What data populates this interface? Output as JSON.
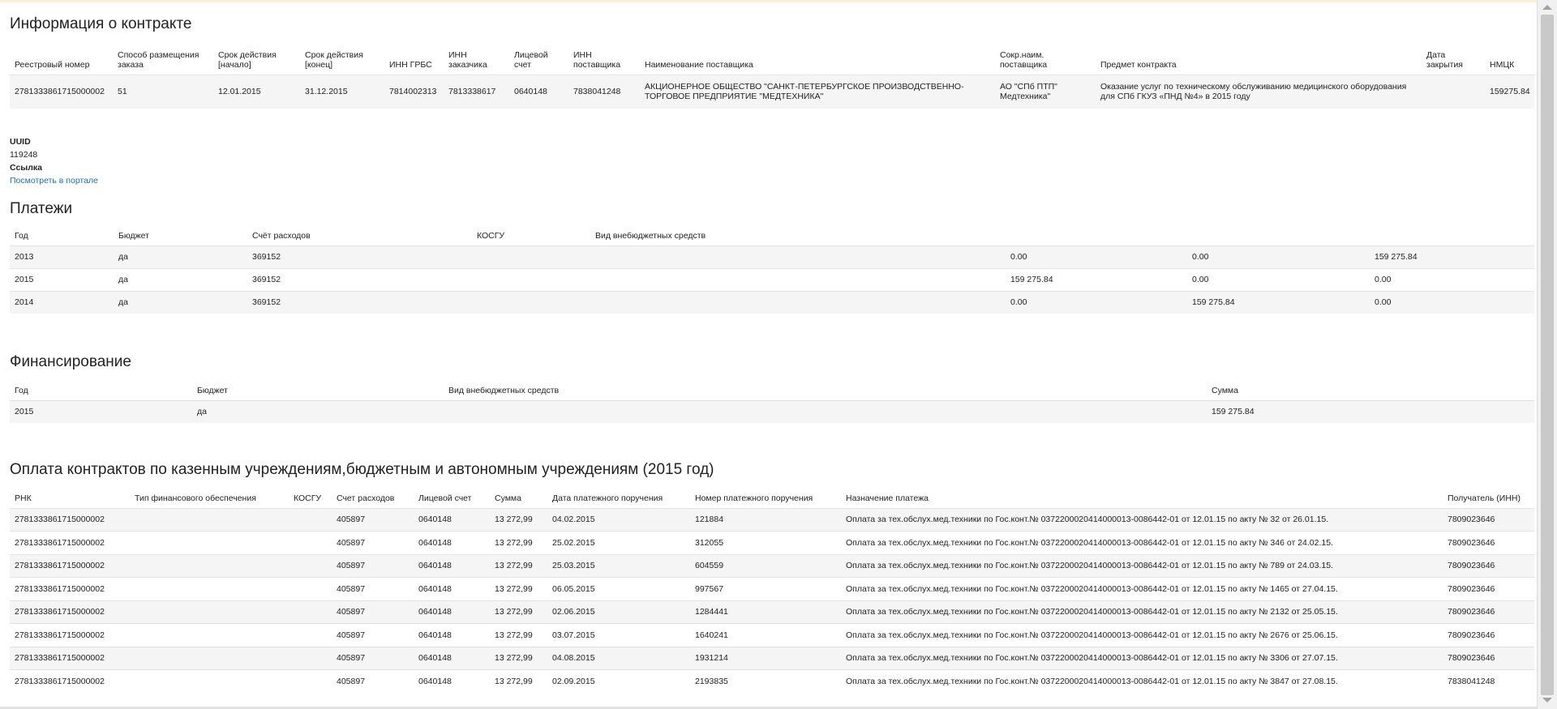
{
  "contract": {
    "title": "Информация о контракте",
    "headers": [
      "Реестровый номер",
      "Способ размещения заказа",
      "Срок действия [начало]",
      "Срок действия [конец]",
      "ИНН ГРБС",
      "ИНН заказчика",
      "Лицевой счет",
      "ИНН поставщика",
      "Наименование поставщика",
      "Сокр.наим. поставщика",
      "Предмет контракта",
      "Дата закрытия",
      "НМЦК"
    ],
    "row": [
      "2781333861715000002",
      "51",
      "12.01.2015",
      "31.12.2015",
      "7814002313",
      "7813338617",
      "0640148",
      "7838041248",
      "АКЦИОНЕРНОЕ ОБЩЕСТВО \"САНКТ-ПЕТЕРБУРГСКОЕ ПРОИЗВОДСТВЕННО-ТОРГОВОЕ ПРЕДПРИЯТИЕ \"МЕДТЕХНИКА\"",
      "АО \"СПб ПТП\" Медтехника\"",
      "Оказание услуг по техническому обслуживанию медицинского оборудования для СПб ГКУЗ «ПНД №4» в 2015 году",
      "",
      "159275.84"
    ]
  },
  "meta": {
    "uuid_label": "UUID",
    "uuid_value": "119248",
    "link_label": "Ссылка",
    "link_text": "Посмотреть в портале"
  },
  "payments": {
    "title": "Платежи",
    "headers": [
      "Год",
      "Бюджет",
      "Счёт расходов",
      "КОСГУ",
      "Вид внебюджетных средств",
      "",
      "",
      ""
    ],
    "rows": [
      [
        "2013",
        "да",
        "369152",
        "",
        "",
        "0.00",
        "0.00",
        "159 275.84"
      ],
      [
        "2015",
        "да",
        "369152",
        "",
        "",
        "159 275.84",
        "0.00",
        "0.00"
      ],
      [
        "2014",
        "да",
        "369152",
        "",
        "",
        "0.00",
        "159 275.84",
        "0.00"
      ]
    ]
  },
  "financing": {
    "title": "Финансирование",
    "headers": [
      "Год",
      "Бюджет",
      "Вид внебюджетных средств",
      "Сумма"
    ],
    "rows": [
      [
        "2015",
        "да",
        "",
        "159 275.84"
      ]
    ]
  },
  "treasury": {
    "title": "Оплата контрактов по казенным учреждениям,бюджетным и автономным учреждениям (2015 год)",
    "headers": [
      "РНК",
      "Тип финансового обеспечения",
      "КОСГУ",
      "Счет расходов",
      "Лицевой счет",
      "Сумма",
      "Дата платежного поручения",
      "Номер платежного поручения",
      "Назначение платежа",
      "Получатель (ИНН)"
    ],
    "rows": [
      [
        "2781333861715000002",
        "",
        "",
        "405897",
        "0640148",
        "13 272,99",
        "04.02.2015",
        "121884",
        "Оплата за тех.обслух.мед.техники по Гос.конт.№ 0372200020414000013-0086442-01 от 12.01.15 по акту № 32 от 26.01.15.",
        "7809023646"
      ],
      [
        "2781333861715000002",
        "",
        "",
        "405897",
        "0640148",
        "13 272,99",
        "25.02.2015",
        "312055",
        "Оплата за тех.обслух.мед.техники по Гос.конт.№ 0372200020414000013-0086442-01 от 12.01.15 по акту № 346 от 24.02.15.",
        "7809023646"
      ],
      [
        "2781333861715000002",
        "",
        "",
        "405897",
        "0640148",
        "13 272,99",
        "25.03.2015",
        "604559",
        "Оплата за тех.обслух.мед.техники по Гос.конт.№ 0372200020414000013-0086442-01 от 12.01.15 по акту № 789 от 24.03.15.",
        "7809023646"
      ],
      [
        "2781333861715000002",
        "",
        "",
        "405897",
        "0640148",
        "13 272,99",
        "06.05.2015",
        "997567",
        "Оплата за тех.обслух.мед.техники по Гос.конт.№ 0372200020414000013-0086442-01 от 12.01.15 по акту № 1465 от 27.04.15.",
        "7809023646"
      ],
      [
        "2781333861715000002",
        "",
        "",
        "405897",
        "0640148",
        "13 272,99",
        "02.06.2015",
        "1284441",
        "Оплата за тех.обслух.мед.техники по Гос.конт.№ 0372200020414000013-0086442-01 от 12.01.15 по акту № 2132 от 25.05.15.",
        "7809023646"
      ],
      [
        "2781333861715000002",
        "",
        "",
        "405897",
        "0640148",
        "13 272,99",
        "03.07.2015",
        "1640241",
        "Оплата за тех.обслух.мед.техники по Гос.конт.№ 0372200020414000013-0086442-01 от 12.01.15 по акту № 2676 от 25.06.15.",
        "7809023646"
      ],
      [
        "2781333861715000002",
        "",
        "",
        "405897",
        "0640148",
        "13 272,99",
        "04.08.2015",
        "1931214",
        "Оплата за тех.обслух.мед.техники по Гос.конт.№ 0372200020414000013-0086442-01 от 12.01.15 по акту № 3306 от 27.07.15.",
        "7809023646"
      ],
      [
        "2781333861715000002",
        "",
        "",
        "405897",
        "0640148",
        "13 272,99",
        "02.09.2015",
        "2193835",
        "Оплата за тех.обслух.мед.техники по Гос.конт.№ 0372200020414000013-0086442-01 от 12.01.15 по акту № 3847 от 27.08.15.",
        "7838041248"
      ]
    ]
  }
}
